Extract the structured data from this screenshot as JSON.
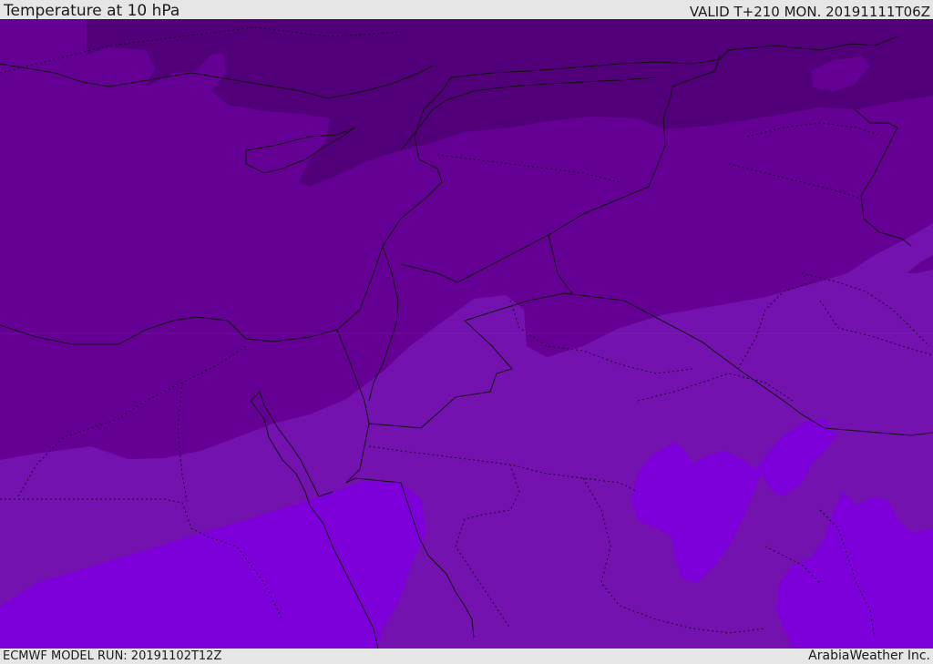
{
  "header": {
    "title": "Temperature at 10 hPa",
    "valid_time": "VALID T+210 MON. 20191111T06Z"
  },
  "footer": {
    "model_run": "ECMWF MODEL RUN: 20191102T12Z",
    "credit": "ArabiaWeather Inc."
  },
  "colors": {
    "band_darkest": "#52007a",
    "band_dark": "#650095",
    "band_mid": "#7412b0",
    "band_bright": "#7d00da",
    "border_line": "#111111"
  }
}
